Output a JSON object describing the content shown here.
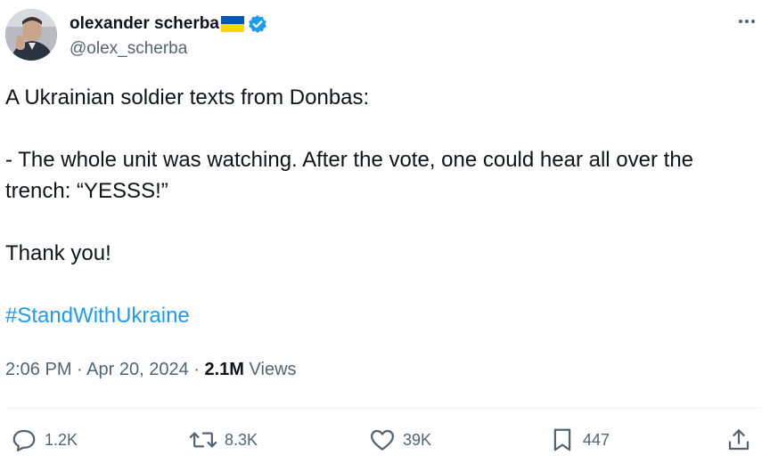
{
  "author": {
    "display_name": "olexander scherba",
    "handle": "@olex_scherba",
    "verified": true,
    "flag": "ukraine-flag"
  },
  "tweet": {
    "line1": "A Ukrainian soldier texts from Donbas:",
    "line2": "- The whole unit was watching. After the vote, one could hear all over the trench: “YESSS!”",
    "line3": "Thank you!",
    "hashtag": "#StandWithUkraine"
  },
  "meta": {
    "time": "2:06 PM",
    "separator": "·",
    "date": "Apr 20, 2024",
    "views_count": "2.1M",
    "views_label": "Views"
  },
  "actions": {
    "replies": "1.2K",
    "retweets": "8.3K",
    "likes": "39K",
    "bookmarks": "447"
  },
  "colors": {
    "link": "#1d9bf0",
    "secondary_text": "#536471",
    "primary_text": "#0f1419",
    "verified": "#1d9bf0",
    "flag_blue": "#0057b7",
    "flag_yellow": "#ffd700"
  }
}
